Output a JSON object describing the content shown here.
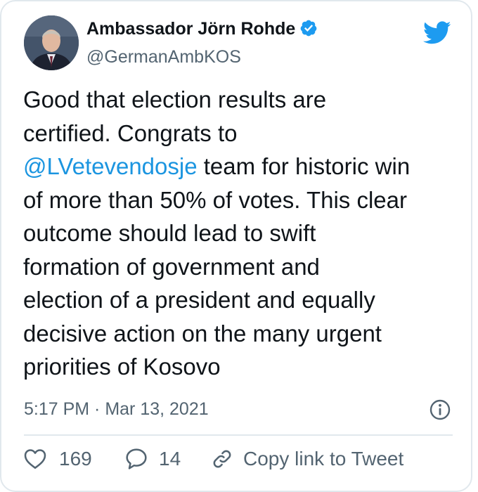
{
  "author": {
    "name": "Ambassador Jörn Rohde",
    "handle": "@GermanAmbKOS",
    "verified": true,
    "verified_icon": "verified-badge-icon"
  },
  "tweet": {
    "text_lines": [
      [
        {
          "text": "Good that election results are",
          "mention": false
        }
      ],
      [
        {
          "text": "certified. Congrats to",
          "mention": false
        }
      ],
      [
        {
          "text": "@LVetevendosje",
          "mention": true
        },
        {
          "text": " team for historic win",
          "mention": false
        }
      ],
      [
        {
          "text": "of more than 50% of votes. This clear",
          "mention": false
        }
      ],
      [
        {
          "text": "outcome should lead to swift",
          "mention": false
        }
      ],
      [
        {
          "text": "formation of government and",
          "mention": false
        }
      ],
      [
        {
          "text": "election of a president and equally",
          "mention": false
        }
      ],
      [
        {
          "text": "decisive action on the many urgent",
          "mention": false
        }
      ],
      [
        {
          "text": "priorities of Kosovo",
          "mention": false
        }
      ]
    ],
    "timestamp": "5:17 PM · Mar 13, 2021"
  },
  "actions": {
    "likes": "169",
    "replies": "14",
    "copy_link_label": "Copy link to Tweet"
  },
  "colors": {
    "mention": "#1b95e0",
    "twitter_blue": "#1d9bf0",
    "secondary_text": "#536471",
    "primary_text": "#0f1419",
    "border": "#e1e8ed"
  }
}
